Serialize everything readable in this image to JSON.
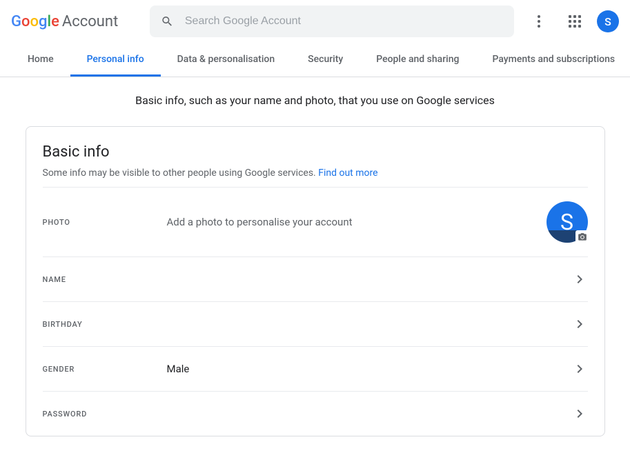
{
  "header": {
    "product_name": "Account",
    "search_placeholder": "Search Google Account",
    "avatar_letter": "S"
  },
  "tabs": [
    {
      "label": "Home",
      "active": false
    },
    {
      "label": "Personal info",
      "active": true
    },
    {
      "label": "Data & personalisation",
      "active": false
    },
    {
      "label": "Security",
      "active": false
    },
    {
      "label": "People and sharing",
      "active": false
    },
    {
      "label": "Payments and subscriptions",
      "active": false
    }
  ],
  "page_subtitle": "Basic info, such as your name and photo, that you use on Google services",
  "basic_info": {
    "title": "Basic info",
    "desc": "Some info may be visible to other people using Google services. ",
    "find_out_more": "Find out more",
    "photo": {
      "label": "PHOTO",
      "desc": "Add a photo to personalise your account",
      "avatar_letter": "S"
    },
    "rows": [
      {
        "label": "NAME",
        "value": ""
      },
      {
        "label": "BIRTHDAY",
        "value": ""
      },
      {
        "label": "GENDER",
        "value": "Male"
      },
      {
        "label": "PASSWORD",
        "value": ""
      }
    ]
  }
}
